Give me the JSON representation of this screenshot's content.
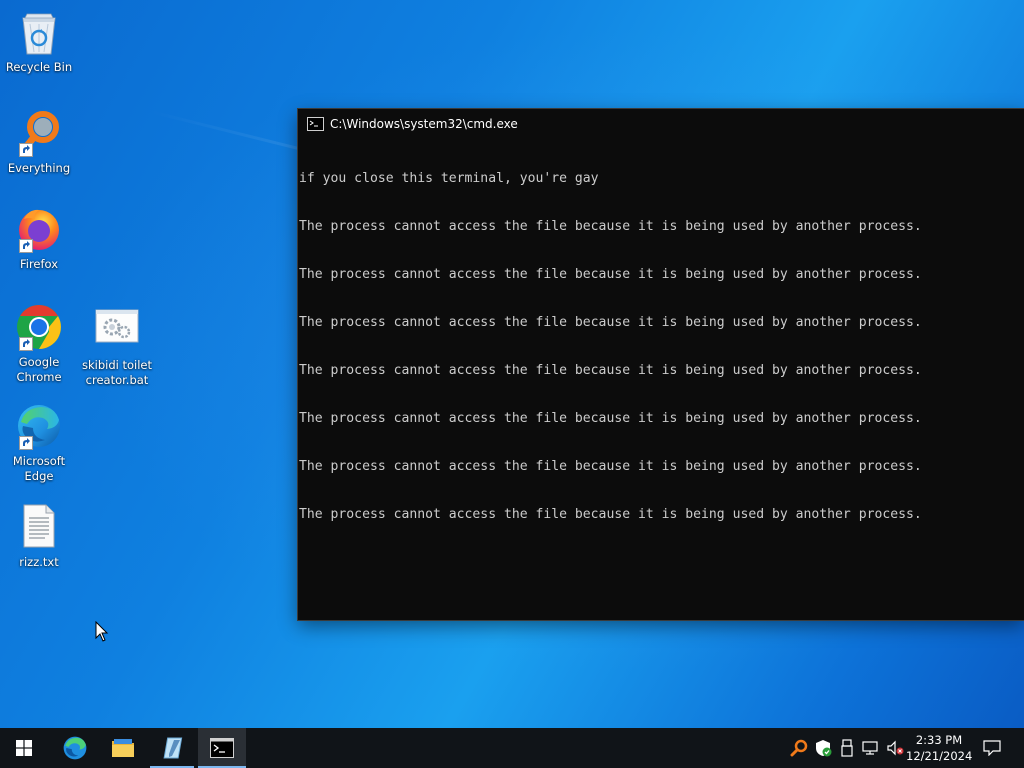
{
  "desktop": {
    "icons": {
      "recycle_bin": "Recycle Bin",
      "everything": "Everything",
      "firefox": "Firefox",
      "chrome": "Google Chrome",
      "bat_file": "skibidi toilet creator.bat",
      "edge": "Microsoft Edge",
      "txt_file": "rizz.txt"
    }
  },
  "cmd_window": {
    "title": "C:\\Windows\\system32\\cmd.exe",
    "lines": [
      "if you close this terminal, you're gay",
      "The process cannot access the file because it is being used by another process.",
      "The process cannot access the file because it is being used by another process.",
      "The process cannot access the file because it is being used by another process.",
      "The process cannot access the file because it is being used by another process.",
      "The process cannot access the file because it is being used by another process.",
      "The process cannot access the file because it is being used by another process.",
      "The process cannot access the file because it is being used by another process."
    ]
  },
  "taskbar": {
    "pinned": [
      "start-icon",
      "edge-icon",
      "file-explorer-icon",
      "notepad-icon",
      "cmd-icon"
    ],
    "tray_icons": [
      "everything-tray-icon",
      "security-shield-icon",
      "usb-eject-icon",
      "network-icon",
      "volume-muted-icon"
    ],
    "clock": {
      "time": "2:33 PM",
      "date": "12/21/2024"
    }
  },
  "colors": {
    "desktop_blue": "#0f80e0",
    "taskbar": "#101418",
    "console_bg": "#0c0c0c",
    "console_text": "#cccccc",
    "active_indicator": "#7cb7f0"
  }
}
